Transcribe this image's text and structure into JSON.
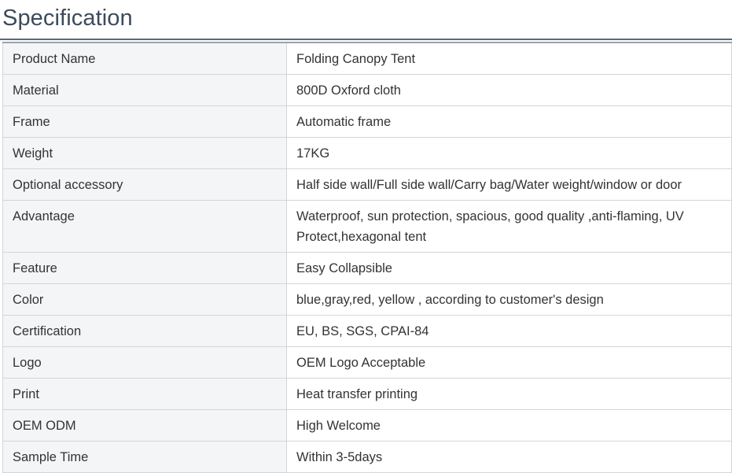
{
  "section": {
    "title": "Specification"
  },
  "specs": [
    {
      "label": "Product Name",
      "value": "Folding Canopy Tent"
    },
    {
      "label": "Material",
      "value": "800D Oxford cloth"
    },
    {
      "label": "Frame",
      "value": "Automatic frame"
    },
    {
      "label": "Weight",
      "value": "17KG"
    },
    {
      "label": "Optional accessory",
      "value": "Half side wall/Full side wall/Carry bag/Water weight/window or door"
    },
    {
      "label": "Advantage",
      "value": "Waterproof, sun protection, spacious, good quality ,anti-flaming, UV Protect,hexagonal tent"
    },
    {
      "label": "Feature",
      "value": "Easy Collapsible"
    },
    {
      "label": "Color",
      "value": "blue,gray,red, yellow , according to customer's design"
    },
    {
      "label": "Certification",
      "value": "EU, BS, SGS, CPAI-84"
    },
    {
      "label": "Logo",
      "value": "OEM Logo Acceptable"
    },
    {
      "label": "Print",
      "value": "Heat transfer printing"
    },
    {
      "label": "OEM ODM",
      "value": "High Welcome"
    },
    {
      "label": "Sample Time",
      "value": "Within 3-5days"
    }
  ]
}
